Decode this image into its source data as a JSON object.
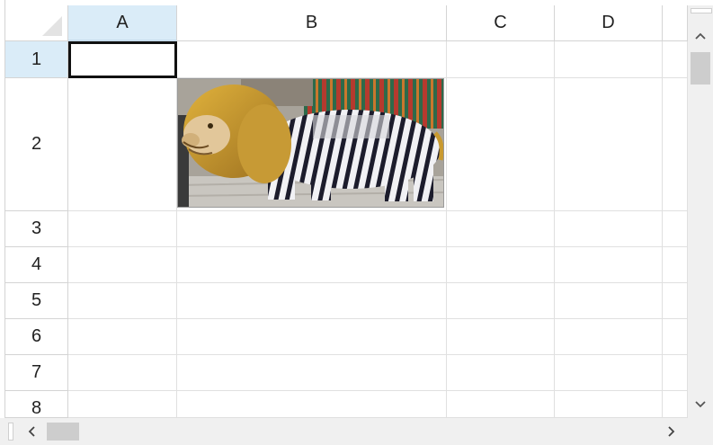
{
  "columns": [
    "A",
    "B",
    "C",
    "D"
  ],
  "rows": [
    "1",
    "2",
    "3",
    "4",
    "5",
    "6",
    "7",
    "8"
  ],
  "selected_cell": "A1",
  "selected_column": "A",
  "selected_row": "1",
  "picture": {
    "cell": "B2",
    "description_icon": "lion-statue-image"
  },
  "scrollbars": {
    "up_icon": "chevron-up-icon",
    "down_icon": "chevron-down-icon",
    "left_icon": "chevron-left-icon",
    "right_icon": "chevron-right-icon"
  },
  "colors": {
    "selected_header_bg": "#daecf8",
    "grid_line": "#e0e0e0",
    "header_border": "#d4d4d4",
    "scrollbar_bg": "#f0f0f0",
    "scrollbar_thumb": "#cdcdcd",
    "active_cell_border": "#111111"
  }
}
